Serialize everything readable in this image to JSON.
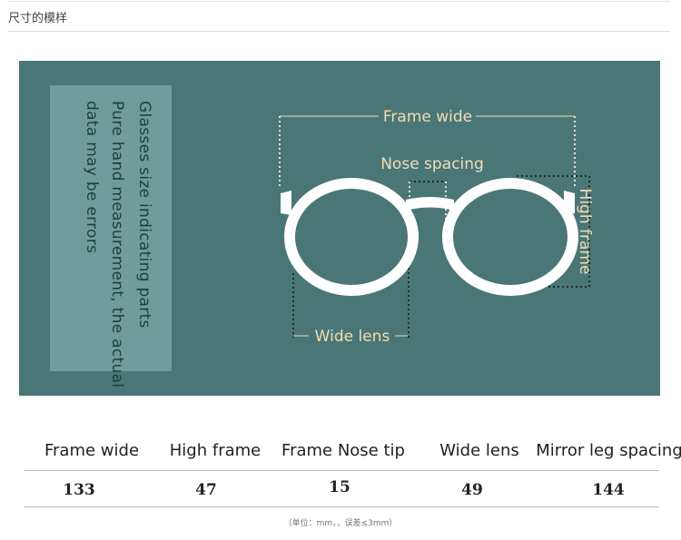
{
  "header": {
    "title": "尺寸的模样"
  },
  "diagram": {
    "note_lines": [
      "Glasses size indicating parts",
      "Pure hand measurement, the actual",
      "data may be errors"
    ],
    "labels": {
      "frame_wide": "Frame wide",
      "nose_spacing": "Nose spacing",
      "high_frame": "High frame",
      "wide_lens": "Wide lens"
    }
  },
  "table": {
    "headers": [
      "Frame wide",
      "High frame",
      "Frame Nose tip",
      "Wide lens",
      "Mirror leg spacing"
    ],
    "values": [
      "133",
      "47",
      "15",
      "49",
      "144"
    ]
  },
  "footnote": "（单位：mm，，误差≤3mm）"
}
